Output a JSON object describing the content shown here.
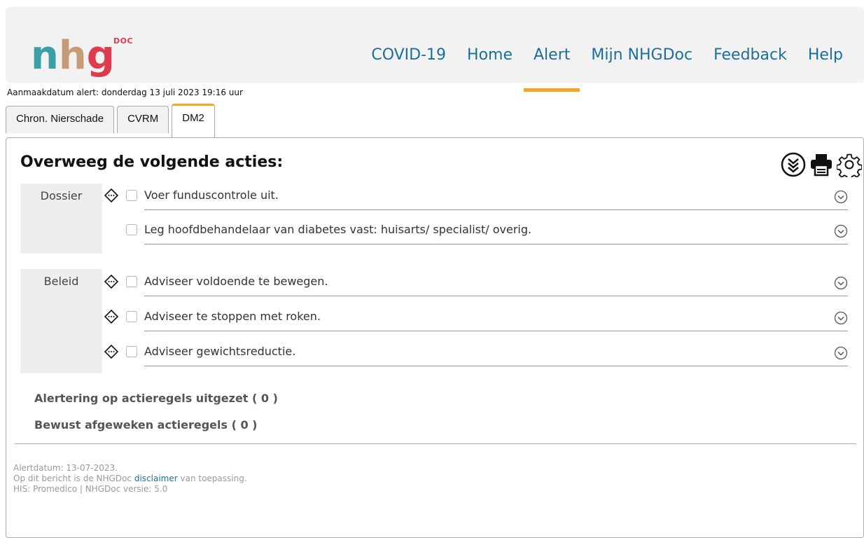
{
  "logo": {
    "letters": [
      "n",
      "h",
      "g"
    ],
    "suffix": "DOC"
  },
  "nav": {
    "items": [
      "COVID-19",
      "Home",
      "Alert",
      "Mijn NHGDoc",
      "Feedback",
      "Help"
    ],
    "active": "Alert"
  },
  "creation_date": "Aanmaakdatum alert: donderdag 13 juli 2023 19:16 uur",
  "tabs": [
    "Chron. Nierschade",
    "CVRM",
    "DM2"
  ],
  "active_tab": "DM2",
  "panel": {
    "title": "Overweeg de volgende acties:",
    "icons": [
      "expand-all-icon",
      "print-icon",
      "settings-gear-icon"
    ],
    "groups": [
      {
        "label": "Dossier",
        "rows": [
          {
            "text": "Voer funduscontrole uit.",
            "has_diamond": true
          },
          {
            "text": "Leg hoofdbehandelaar van diabetes vast: huisarts/ specialist/ overig.",
            "has_diamond": false
          }
        ]
      },
      {
        "label": "Beleid",
        "rows": [
          {
            "text": "Adviseer voldoende te bewegen.",
            "has_diamond": true
          },
          {
            "text": "Adviseer te stoppen met roken.",
            "has_diamond": true
          },
          {
            "text": "Adviseer gewichtsreductie.",
            "has_diamond": true
          }
        ]
      }
    ],
    "disabled_rules": "Alertering op actieregels uitgezet ( 0 )",
    "deviated_rules": "Bewust afgeweken actieregels ( 0 )"
  },
  "footer": {
    "alert_date": "Alertdatum: 13-07-2023.",
    "disclaimer_prefix": "Op dit bericht is de NHGDoc ",
    "disclaimer_link": "disclaimer",
    "disclaimer_suffix": " van toepassing.",
    "his": "HIS: Promedico | NHGDoc versie: 5.0"
  },
  "colors": {
    "accent": "#f5a623",
    "nav_link": "#1b6f9a",
    "logo_teal": "#3aa0a6",
    "logo_red": "#e03a4f"
  }
}
